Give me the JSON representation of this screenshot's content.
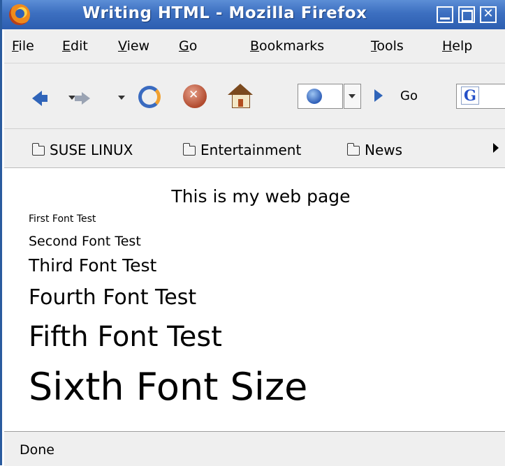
{
  "window": {
    "title": "Writing HTML - Mozilla Firefox"
  },
  "menu": [
    {
      "underline": "F",
      "rest": "ile"
    },
    {
      "underline": "E",
      "rest": "dit"
    },
    {
      "underline": "V",
      "rest": "iew"
    },
    {
      "underline": "G",
      "rest": "o"
    },
    {
      "underline": "B",
      "rest": "ookmarks"
    },
    {
      "underline": "T",
      "rest": "ools"
    },
    {
      "underline": "H",
      "rest": "elp"
    }
  ],
  "navigation": {
    "go_label": "Go",
    "search_engine_icon": "G"
  },
  "bookmarks": [
    "SUSE LINUX",
    "Entertainment",
    "News"
  ],
  "page": {
    "heading": "This is my web page",
    "lines": [
      "First Font Test",
      "Second Font Test",
      "Third Font Test",
      "Fourth Font Test",
      "Fifth Font Test",
      "Sixth Font Size"
    ]
  },
  "status": {
    "text": "Done"
  },
  "icons": {
    "back": "back-arrow-icon",
    "forward": "forward-arrow-icon",
    "reload": "reload-icon",
    "stop": "stop-icon",
    "home": "home-icon",
    "site": "globe-icon",
    "go": "go-icon",
    "search": "google-icon"
  }
}
